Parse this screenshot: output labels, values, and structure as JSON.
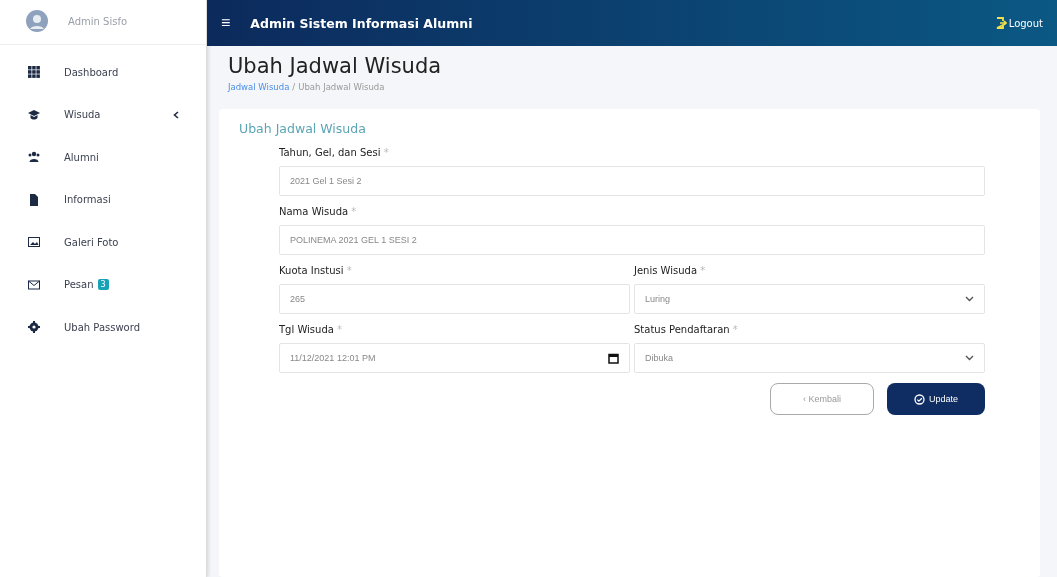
{
  "sidebar": {
    "user": "Admin Sisfo",
    "items": [
      {
        "label": "Dashboard",
        "submenu": false
      },
      {
        "label": "Wisuda",
        "submenu": true
      },
      {
        "label": "Alumni",
        "submenu": false
      },
      {
        "label": "Informasi",
        "submenu": false
      },
      {
        "label": "Galeri Foto",
        "submenu": false
      },
      {
        "label": "Pesan",
        "submenu": false,
        "badge": "3"
      },
      {
        "label": "Ubah Password",
        "submenu": false
      }
    ]
  },
  "topbar": {
    "menu_glyph": "≡",
    "title": "Admin Sistem Informasi Alumni",
    "logout": "Logout"
  },
  "page": {
    "title": "Ubah Jadwal Wisuda",
    "separator": "/",
    "breadcrumb": [
      {
        "label": "Jadwal Wisuda",
        "selected": false
      },
      {
        "label": "Ubah Jadwal Wisuda",
        "selected": true
      }
    ]
  },
  "form": {
    "title": "Ubah Jadwal Wisuda",
    "rows": [
      [
        {
          "label": "Tahun, Gel, dan Sesi",
          "required_mark": "*",
          "kind": "text",
          "value": "2021 Gel 1 Sesi 2"
        }
      ],
      [
        {
          "label": "Nama Wisuda",
          "required_mark": "*",
          "kind": "text",
          "value": "POLINEMA 2021 GEL 1 SESI 2"
        }
      ],
      [
        {
          "label": "Kuota Instusi",
          "required_mark": "*",
          "kind": "text",
          "value": "265"
        },
        {
          "label": "Jenis Wisuda",
          "required_mark": "*",
          "kind": "select",
          "value": "Luring"
        }
      ],
      [
        {
          "label": "Tgl Wisuda",
          "required_mark": "*",
          "kind": "date",
          "value": "11/12/2021 12:01 PM"
        },
        {
          "label": "Status Pendaftaran",
          "required_mark": "*",
          "kind": "select",
          "value": "Dibuka"
        }
      ]
    ],
    "back": "‹ Kembali",
    "submit": "Update"
  }
}
